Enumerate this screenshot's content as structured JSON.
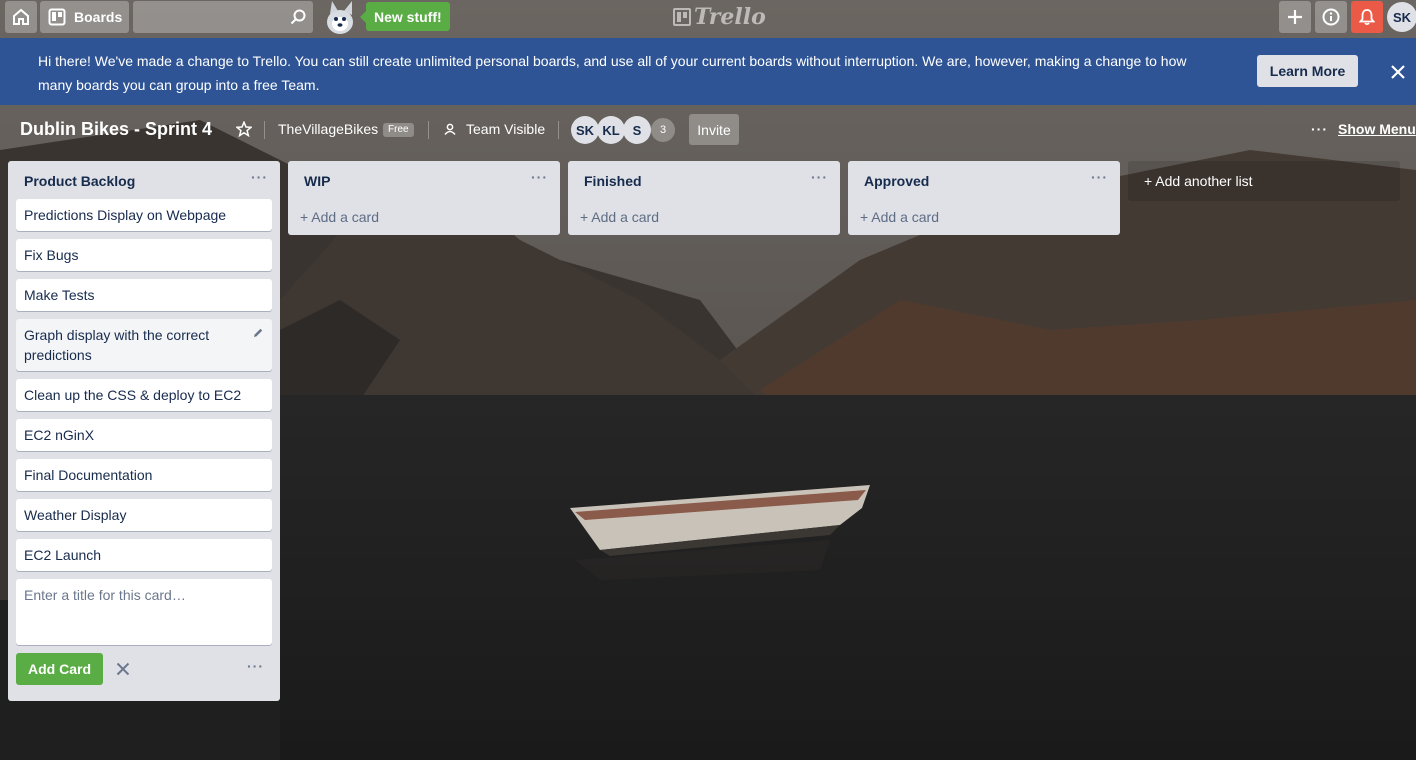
{
  "header": {
    "boards_label": "Boards",
    "new_stuff_label": "New stuff!",
    "logo_text": "Trello",
    "user_initials": "SK"
  },
  "banner": {
    "message": "Hi there! We've made a change to Trello. You can still create unlimited personal boards, and use all of your current boards without interruption. We are, however, making a change to how many boards you can group into a free Team.",
    "learn_more_label": "Learn More"
  },
  "board": {
    "title": "Dublin Bikes - Sprint 4",
    "team_name": "TheVillageBikes",
    "team_badge": "Free",
    "visibility": "Team Visible",
    "members": [
      "SK",
      "KL",
      "S"
    ],
    "member_count": "3",
    "invite_label": "Invite",
    "show_menu_label": "Show Menu"
  },
  "lists": [
    {
      "title": "Product Backlog",
      "cards": [
        "Predictions Display on Webpage",
        "Fix Bugs",
        "Make Tests",
        "Graph display with the correct predictions",
        "Clean up the CSS & deploy to EC2",
        "EC2 nGinX",
        "Final Documentation",
        "Weather Display",
        "EC2 Launch"
      ],
      "composer_placeholder": "Enter a title for this card…",
      "add_card_button": "Add Card"
    },
    {
      "title": "WIP",
      "add_card_label": "+ Add a card"
    },
    {
      "title": "Finished",
      "add_card_label": "+ Add a card"
    },
    {
      "title": "Approved",
      "add_card_label": "+ Add a card"
    }
  ],
  "add_list_label": "+ Add another list",
  "colors": {
    "banner_bg": "#2e5496",
    "list_bg": "#dfe1e6",
    "green": "#5aac44",
    "notification_red": "#eb5a46"
  }
}
